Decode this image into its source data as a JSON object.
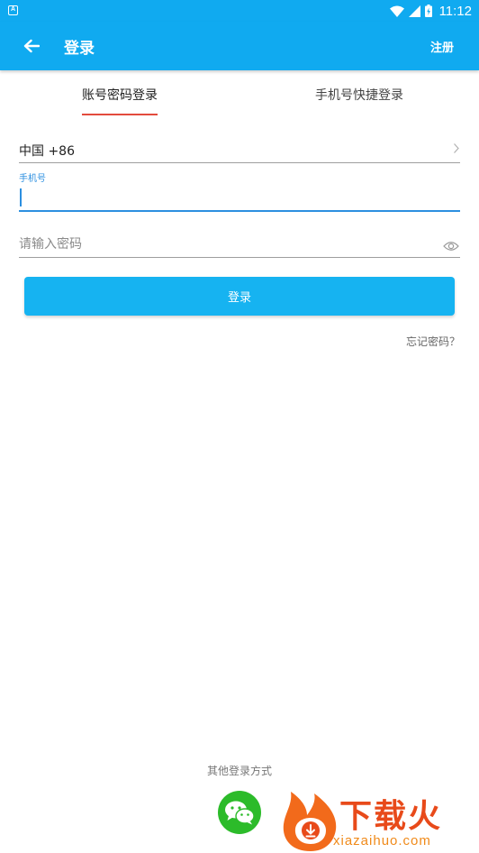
{
  "status_bar": {
    "notification_icon": "A",
    "time": "11:12",
    "icons": [
      "wifi-icon",
      "signal-icon",
      "battery-icon"
    ]
  },
  "app_bar": {
    "title": "登录",
    "register_label": "注册",
    "back_icon": "arrow-left-icon"
  },
  "tabs": [
    {
      "label": "账号密码登录",
      "selected": true
    },
    {
      "label": "手机号快捷登录",
      "selected": false
    }
  ],
  "form": {
    "country_code": "中国 +86",
    "phone_label": "手机号",
    "phone_value": "",
    "password_placeholder": "请输入密码",
    "login_button": "登录",
    "forgot_password": "忘记密码？"
  },
  "other_login": {
    "title": "其他登录方式",
    "wechat_icon": "wechat-icon"
  },
  "watermark": {
    "brand": "下载火",
    "url": "xiazaihuo.com"
  },
  "colors": {
    "primary": "#10aaf0",
    "button": "#16b3f1",
    "tab_indicator": "#e34b3d",
    "focus": "#2c8fe0",
    "wechat": "#2cbb2a"
  }
}
